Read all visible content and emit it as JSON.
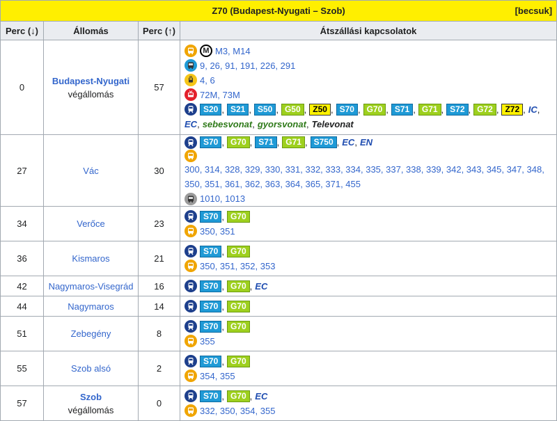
{
  "header": {
    "title": "Z70 (Budapest-Nyugati – Szob)",
    "collapse_label": "[becsuk]"
  },
  "columns": [
    "Perc (↓)",
    "Állomás",
    "Perc (↑)",
    "Átszállási kapcsolatok"
  ],
  "colors": {
    "header_yellow": "#ffef00",
    "header_gray": "#eaecf0",
    "link_blue": "#3366cc",
    "S_line": "#1f9ad6",
    "G_line": "#9ed01e",
    "Z_line": "#fff200",
    "bus": "#f0a500",
    "train": "#1d3f8c",
    "trolley": "#e3202b",
    "tram": "#f5c518",
    "intercity_bus": "#8f8f8f"
  },
  "rows": [
    {
      "down": "0",
      "station": "Budapest-Nyugati",
      "sub": "végállomás",
      "up": "57",
      "connections": {
        "metro": "M3, M14",
        "bus": "9, 26, 91, 191, 226, 291",
        "tram": "4, 6",
        "trolley": "72M, 73M",
        "rail_badges": [
          "S20",
          "S21",
          "S50",
          "G50",
          "Z50",
          "S70",
          "G70",
          "S71",
          "G71",
          "S72",
          "G72",
          "Z72"
        ],
        "train_types": [
          "IC",
          "EC",
          "sebesvonat",
          "gyorsvonat",
          "Televonat"
        ]
      }
    },
    {
      "down": "27",
      "station": "Vác",
      "up": "30",
      "connections": {
        "rail_badges": [
          "S70",
          "G70",
          "S71",
          "G71",
          "S750"
        ],
        "train_types": [
          "EC",
          "EN"
        ],
        "bus": "300, 314, 328, 329, 330, 331, 332, 333, 334, 335, 337, 338, 339, 342, 343, 345, 347, 348, 350, 351, 361, 362, 363, 364, 365, 371, 455",
        "city_bus": "1010, 1013"
      }
    },
    {
      "down": "34",
      "station": "Verőce",
      "up": "23",
      "connections": {
        "rail_badges": [
          "S70",
          "G70"
        ],
        "bus": "350, 351"
      }
    },
    {
      "down": "36",
      "station": "Kismaros",
      "up": "21",
      "connections": {
        "rail_badges": [
          "S70",
          "G70"
        ],
        "bus": "350, 351, 352, 353"
      }
    },
    {
      "down": "42",
      "station": "Nagymaros-Visegrád",
      "up": "16",
      "connections": {
        "rail_badges": [
          "S70",
          "G70"
        ],
        "train_types": [
          "EC"
        ]
      }
    },
    {
      "down": "44",
      "station": "Nagymaros",
      "up": "14",
      "connections": {
        "rail_badges": [
          "S70",
          "G70"
        ]
      }
    },
    {
      "down": "51",
      "station": "Zebegény",
      "up": "8",
      "connections": {
        "rail_badges": [
          "S70",
          "G70"
        ],
        "bus": "355"
      }
    },
    {
      "down": "55",
      "station": "Szob alsó",
      "up": "2",
      "connections": {
        "rail_badges": [
          "S70",
          "G70"
        ],
        "bus": "354, 355"
      }
    },
    {
      "down": "57",
      "station": "Szob",
      "sub": "végállomás",
      "up": "0",
      "connections": {
        "rail_badges": [
          "S70",
          "G70"
        ],
        "train_types": [
          "EC"
        ],
        "bus": "332, 350, 354, 355"
      }
    }
  ]
}
